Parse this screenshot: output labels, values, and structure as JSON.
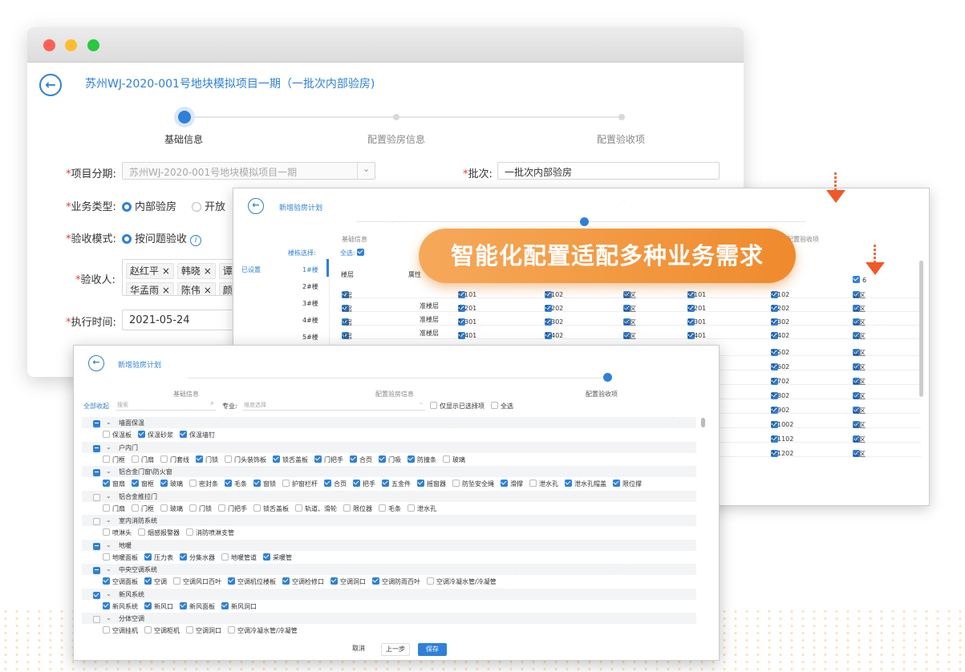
{
  "w1": {
    "title": "苏州WJ-2020-001号地块模拟项目一期（一批次内部验房)",
    "steps": [
      "基础信息",
      "配置验房信息",
      "配置验收项"
    ],
    "f_project_label": "项目分期:",
    "f_project_value": "苏州WJ-2020-001号地块模拟项目一期",
    "f_batch_label": "批次:",
    "f_batch_value": "一批次内部验房",
    "f_type_label": "业务类型:",
    "f_type_opt1": "内部验房",
    "f_type_opt2": "开放",
    "f_mode_label": "验收模式:",
    "f_mode_opt1": "按问题验收",
    "f_people_label": "验收人:",
    "people_row1": [
      "赵红平",
      "韩晓",
      "谭"
    ],
    "people_row2": [
      "华孟雨",
      "陈伟",
      "颜"
    ],
    "f_time_label": "执行时间:",
    "f_time_value": "2021-05-24"
  },
  "w2": {
    "title": "新增验房计划",
    "step1": "基础信息",
    "step3": "配置验收项",
    "building_select": "楼栋选择:",
    "select_all": "全选:",
    "set": "已设置",
    "buildings": [
      "1#楼",
      "2#楼",
      "3#楼",
      "4#楼",
      "5#楼"
    ],
    "col_floor": "楼层",
    "col_attr": "属性",
    "floors": [
      "1层",
      "2层",
      "3层",
      "4层"
    ],
    "attr": "准楼层",
    "grid": [
      [
        "1-101",
        "1-102",
        "公区",
        "2-101",
        "2-102",
        "公区"
      ],
      [
        "1-201",
        "1-202",
        "公区",
        "2-201",
        "2-202",
        "公区"
      ],
      [
        "1-301",
        "1-302",
        "公区",
        "2-301",
        "2-302",
        "公区"
      ],
      [
        "1-401",
        "1-402",
        "公区",
        "2-401",
        "2-402",
        "公区"
      ]
    ],
    "right_rows": [
      [
        "2-502",
        "公区"
      ],
      [
        "2-602",
        "公区"
      ],
      [
        "2-702",
        "公区"
      ],
      [
        "2-802",
        "公区"
      ],
      [
        "2-902",
        "公区"
      ],
      [
        "2-1002",
        "公区"
      ],
      [
        "2-1102",
        "公区"
      ],
      [
        "2-1202",
        "公区"
      ]
    ],
    "top_partial": "6"
  },
  "banner": "智能化配置适配多种业务需求",
  "w3": {
    "title": "新增验房计划",
    "steps": [
      "基础信息",
      "配置验房信息",
      "配置验收项"
    ],
    "collapse_all": "全部收起",
    "search_placeholder": "搜索",
    "major_label": "专业:",
    "major_placeholder": "维度选择",
    "only_selected": "仅显示已选择项",
    "select_all": "全选",
    "sections": [
      {
        "name": "墙面保温",
        "state": "part",
        "items": [
          [
            "保温板",
            "off"
          ],
          [
            "保温砂浆",
            "on"
          ],
          [
            "保温墙钉",
            "on"
          ]
        ]
      },
      {
        "name": "户内门",
        "state": "part",
        "items": [
          [
            "门框",
            "off"
          ],
          [
            "门扇",
            "off"
          ],
          [
            "门套线",
            "off"
          ],
          [
            "门锁",
            "on"
          ],
          [
            "门头装饰板",
            "off"
          ],
          [
            "锁舌盖板",
            "on"
          ],
          [
            "门把手",
            "on"
          ],
          [
            "合页",
            "on"
          ],
          [
            "门吸",
            "on"
          ],
          [
            "防撞条",
            "on"
          ],
          [
            "玻璃",
            "off"
          ]
        ]
      },
      {
        "name": "铝合金门窗\\防火窗",
        "state": "part",
        "items": [
          [
            "窗扇",
            "on"
          ],
          [
            "窗框",
            "on"
          ],
          [
            "玻璃",
            "on"
          ],
          [
            "密封条",
            "off"
          ],
          [
            "毛条",
            "on"
          ],
          [
            "窗锁",
            "on"
          ],
          [
            "护窗栏杆",
            "off"
          ],
          [
            "合页",
            "on"
          ],
          [
            "把手",
            "on"
          ],
          [
            "五金件",
            "on"
          ],
          [
            "摇窗器",
            "on"
          ],
          [
            "防坠安全绳",
            "off"
          ],
          [
            "滑撑",
            "on"
          ],
          [
            "泄水孔",
            "off"
          ],
          [
            "泄水孔帽盖",
            "on"
          ],
          [
            "限位撑",
            "on"
          ]
        ]
      },
      {
        "name": "铝合金推拉门",
        "state": "off",
        "items": [
          [
            "门扇",
            "off"
          ],
          [
            "门框",
            "off"
          ],
          [
            "玻璃",
            "off"
          ],
          [
            "门锁",
            "off"
          ],
          [
            "门把手",
            "off"
          ],
          [
            "锁舌盖板",
            "off"
          ],
          [
            "轨道、滑轮",
            "off"
          ],
          [
            "限位器",
            "off"
          ],
          [
            "毛条",
            "off"
          ],
          [
            "泄水孔",
            "off"
          ]
        ]
      },
      {
        "name": "室内消防系统",
        "state": "off",
        "items": [
          [
            "喷淋头",
            "off"
          ],
          [
            "烟感报警器",
            "off"
          ],
          [
            "消防喷淋支管",
            "off"
          ]
        ]
      },
      {
        "name": "地暖",
        "state": "part",
        "items": [
          [
            "地暖面板",
            "off"
          ],
          [
            "压力表",
            "on"
          ],
          [
            "分集水器",
            "on"
          ],
          [
            "地暖管道",
            "off"
          ],
          [
            "采暖管",
            "on"
          ]
        ]
      },
      {
        "name": "中央空调系统",
        "state": "part",
        "items": [
          [
            "空调面板",
            "on"
          ],
          [
            "空调",
            "on"
          ],
          [
            "空调风口百叶",
            "off"
          ],
          [
            "空调机位楼板",
            "on"
          ],
          [
            "空调检修口",
            "on"
          ],
          [
            "空调洞口",
            "on"
          ],
          [
            "空调防雨百叶",
            "on"
          ],
          [
            "空调冷凝水管/冷凝管",
            "off"
          ]
        ]
      },
      {
        "name": "新风系统",
        "state": "on",
        "items": [
          [
            "新风系统",
            "on"
          ],
          [
            "新风口",
            "on"
          ],
          [
            "新风面板",
            "on"
          ],
          [
            "新风洞口",
            "on"
          ]
        ]
      },
      {
        "name": "分体空调",
        "state": "off",
        "items": [
          [
            "空调挂机",
            "off"
          ],
          [
            "空调柜机",
            "off"
          ],
          [
            "空调洞口",
            "off"
          ],
          [
            "空调冷凝水管/冷凝管",
            "off"
          ]
        ]
      }
    ],
    "btn_cancel": "取消",
    "btn_prev": "上一步",
    "btn_save": "保存"
  }
}
